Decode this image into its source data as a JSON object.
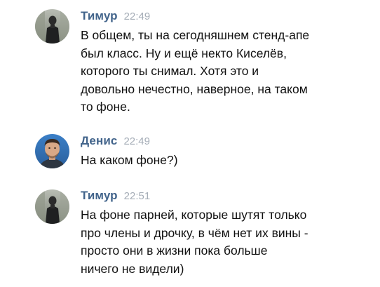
{
  "messages": [
    {
      "author": "Тимур",
      "time": "22:49",
      "avatar_icon": "user-avatar-timur",
      "lines": [
        "В общем, ты на сегодняшнем стенд-апе",
        "был класс. Ну и ещё некто Киселёв,",
        "которого ты снимал. Хотя это и",
        "довольно нечестно, наверное, на таком",
        "то фоне."
      ]
    },
    {
      "author": "Денис",
      "time": "22:49",
      "avatar_icon": "user-avatar-denis",
      "lines": [
        "На каком фоне?)"
      ]
    },
    {
      "author": "Тимур",
      "time": "22:51",
      "avatar_icon": "user-avatar-timur",
      "lines": [
        "На фоне парней, которые шутят только",
        "про члены и дрочку, в чём нет их вины -",
        "просто они в жизни пока больше",
        "ничего не видели)"
      ]
    }
  ],
  "colors": {
    "author": "#42648b",
    "time": "#a5adb7",
    "text": "#111111",
    "background": "#ffffff"
  }
}
